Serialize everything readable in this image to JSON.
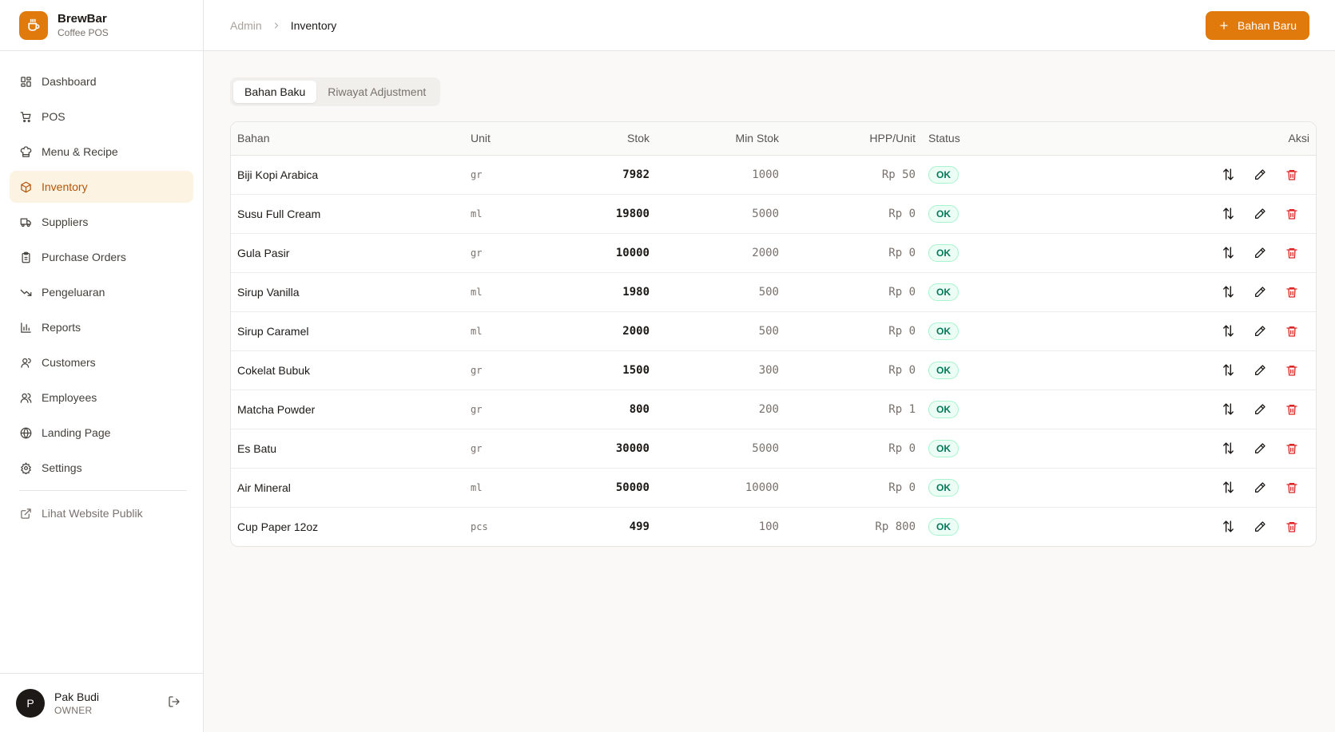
{
  "brand": {
    "name": "BrewBar",
    "subtitle": "Coffee POS"
  },
  "nav": [
    {
      "label": "Dashboard",
      "icon": "grid-icon"
    },
    {
      "label": "POS",
      "icon": "cart-icon"
    },
    {
      "label": "Menu & Recipe",
      "icon": "chef-hat-icon"
    },
    {
      "label": "Inventory",
      "icon": "package-icon"
    },
    {
      "label": "Suppliers",
      "icon": "truck-icon"
    },
    {
      "label": "Purchase Orders",
      "icon": "clipboard-icon"
    },
    {
      "label": "Pengeluaran",
      "icon": "trending-down-icon"
    },
    {
      "label": "Reports",
      "icon": "bar-chart-icon"
    },
    {
      "label": "Customers",
      "icon": "user-icon"
    },
    {
      "label": "Employees",
      "icon": "users-icon"
    },
    {
      "label": "Landing Page",
      "icon": "globe-icon"
    },
    {
      "label": "Settings",
      "icon": "gear-icon"
    }
  ],
  "nav_active": "Inventory",
  "nav_external": {
    "label": "Lihat Website Publik",
    "icon": "external-link-icon"
  },
  "user": {
    "initial": "P",
    "name": "Pak Budi",
    "role": "OWNER"
  },
  "header": {
    "breadcrumb_root": "Admin",
    "breadcrumb_current": "Inventory",
    "primary_button": "Bahan Baru"
  },
  "tabs": [
    "Bahan Baku",
    "Riwayat Adjustment"
  ],
  "active_tab": "Bahan Baku",
  "table": {
    "columns": [
      "Bahan",
      "Unit",
      "Stok",
      "Min Stok",
      "HPP/Unit",
      "Status",
      "Aksi"
    ],
    "rows": [
      {
        "bahan": "Biji Kopi Arabica",
        "unit": "gr",
        "stok": "7982",
        "min_stok": "1000",
        "hpp": "Rp 50",
        "status": "OK"
      },
      {
        "bahan": "Susu Full Cream",
        "unit": "ml",
        "stok": "19800",
        "min_stok": "5000",
        "hpp": "Rp 0",
        "status": "OK"
      },
      {
        "bahan": "Gula Pasir",
        "unit": "gr",
        "stok": "10000",
        "min_stok": "2000",
        "hpp": "Rp 0",
        "status": "OK"
      },
      {
        "bahan": "Sirup Vanilla",
        "unit": "ml",
        "stok": "1980",
        "min_stok": "500",
        "hpp": "Rp 0",
        "status": "OK"
      },
      {
        "bahan": "Sirup Caramel",
        "unit": "ml",
        "stok": "2000",
        "min_stok": "500",
        "hpp": "Rp 0",
        "status": "OK"
      },
      {
        "bahan": "Cokelat Bubuk",
        "unit": "gr",
        "stok": "1500",
        "min_stok": "300",
        "hpp": "Rp 0",
        "status": "OK"
      },
      {
        "bahan": "Matcha Powder",
        "unit": "gr",
        "stok": "800",
        "min_stok": "200",
        "hpp": "Rp 1",
        "status": "OK"
      },
      {
        "bahan": "Es Batu",
        "unit": "gr",
        "stok": "30000",
        "min_stok": "5000",
        "hpp": "Rp 0",
        "status": "OK"
      },
      {
        "bahan": "Air Mineral",
        "unit": "ml",
        "stok": "50000",
        "min_stok": "10000",
        "hpp": "Rp 0",
        "status": "OK"
      },
      {
        "bahan": "Cup Paper 12oz",
        "unit": "pcs",
        "stok": "499",
        "min_stok": "100",
        "hpp": "Rp 800",
        "status": "OK"
      }
    ]
  },
  "colors": {
    "accent": "#e07a0c",
    "active_bg": "#fdf3e3",
    "ok": "#047857",
    "danger": "#dc2626"
  }
}
